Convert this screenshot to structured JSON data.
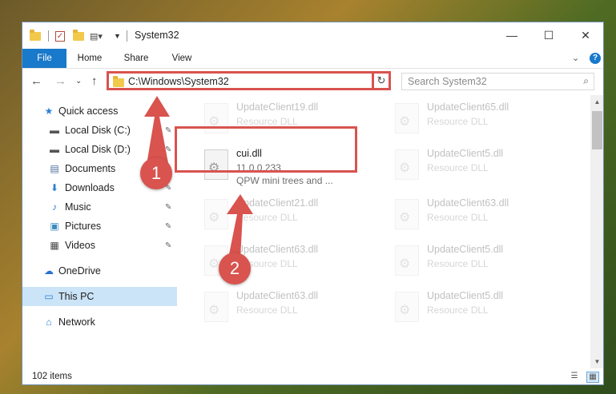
{
  "window": {
    "title": "System32"
  },
  "titlebar": {
    "minimize": "—",
    "maximize": "☐",
    "close": "✕"
  },
  "ribbon": {
    "tabs": [
      "File",
      "Home",
      "Share",
      "View"
    ],
    "expand": "⌄",
    "help": "?"
  },
  "nav": {
    "back": "←",
    "forward": "→",
    "recent": "⌄",
    "up": "↑",
    "address_path": "C:\\Windows\\System32",
    "address_chevron": "⌄",
    "refresh": "↻",
    "search_placeholder": "Search System32",
    "search_icon": "⌕"
  },
  "sidebar": {
    "items": [
      {
        "label": "Quick access",
        "icon": "★",
        "pinned": false
      },
      {
        "label": "Local Disk (C:)",
        "icon": "▬",
        "pinned": true
      },
      {
        "label": "Local Disk (D:)",
        "icon": "▬",
        "pinned": true
      },
      {
        "label": "Documents",
        "icon": "▤",
        "pinned": true
      },
      {
        "label": "Downloads",
        "icon": "⬇",
        "pinned": true
      },
      {
        "label": "Music",
        "icon": "♪",
        "pinned": true
      },
      {
        "label": "Pictures",
        "icon": "▣",
        "pinned": true
      },
      {
        "label": "Videos",
        "icon": "▦",
        "pinned": true
      },
      {
        "label": "OneDrive",
        "icon": "☁",
        "pinned": false
      },
      {
        "label": "This PC",
        "icon": "▭",
        "pinned": false
      },
      {
        "label": "Network",
        "icon": "⌂",
        "pinned": false
      }
    ],
    "pin_icon": "✎"
  },
  "files": {
    "left_column": [
      {
        "name": "UpdateClient19.dll",
        "type": "Resource DLL"
      },
      {
        "name": "cui.dll",
        "type": "11.0.0.233",
        "desc": "QPW mini trees and ..."
      },
      {
        "name": "UpdateClient21.dll",
        "type": "Resource DLL"
      },
      {
        "name": "UpdateClient63.dll",
        "type": "Resource DLL"
      },
      {
        "name": "UpdateClient63.dll",
        "type": "Resource DLL"
      }
    ],
    "right_column": [
      {
        "name": "UpdateClient65.dll",
        "type": "Resource DLL"
      },
      {
        "name": "UpdateClient5.dll",
        "type": "Resource DLL"
      },
      {
        "name": "UpdateClient63.dll",
        "type": "Resource DLL"
      },
      {
        "name": "UpdateClient5.dll",
        "type": "Resource DLL"
      },
      {
        "name": "UpdateClient5.dll",
        "type": "Resource DLL"
      }
    ]
  },
  "callouts": [
    "1",
    "2"
  ],
  "status": {
    "item_count": "102 items"
  },
  "scroll": {
    "up": "▲",
    "down": "▼"
  },
  "colors": {
    "accent": "#1979ca",
    "highlight": "#d9534f",
    "selected": "#cce4f7"
  }
}
